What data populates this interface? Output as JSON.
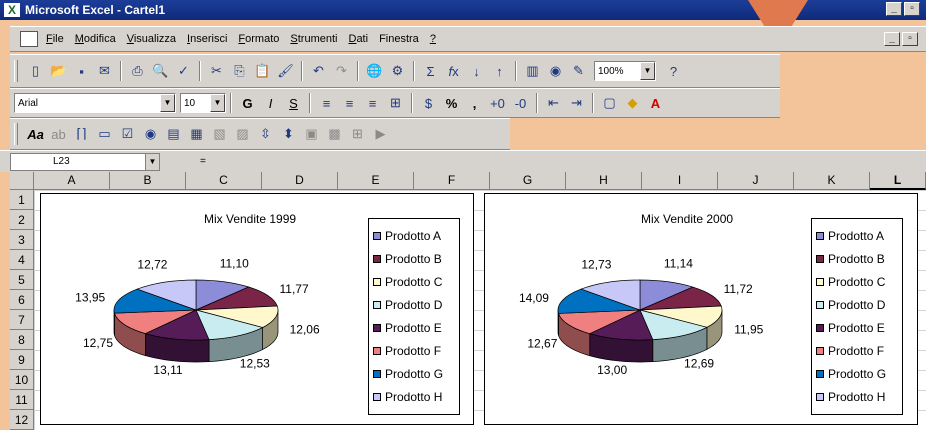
{
  "window": {
    "title": "Microsoft Excel - Cartel1",
    "app_icon": "X"
  },
  "menubar": {
    "items": [
      {
        "first": "F",
        "rest": "ile"
      },
      {
        "first": "M",
        "rest": "odifica"
      },
      {
        "first": "V",
        "rest": "isualizza"
      },
      {
        "first": "I",
        "rest": "nserisci"
      },
      {
        "first": "F",
        "rest": "ormato"
      },
      {
        "first": "S",
        "rest": "trumenti"
      },
      {
        "first": "D",
        "rest": "ati"
      },
      {
        "first": "",
        "rest": "Finestra"
      },
      {
        "first": "?",
        "rest": ""
      }
    ]
  },
  "toolbar_standard": {
    "zoom": "100%"
  },
  "toolbar_formatting": {
    "font": "Arial",
    "size": "10"
  },
  "formula_bar": {
    "cell_ref": "L23",
    "equals": "="
  },
  "columns": [
    "A",
    "B",
    "C",
    "D",
    "E",
    "F",
    "G",
    "H",
    "I",
    "J",
    "K",
    "L"
  ],
  "rows": [
    "1",
    "2",
    "3",
    "4",
    "5",
    "6",
    "7",
    "8",
    "9",
    "10",
    "11",
    "12"
  ],
  "series_colors": [
    "#8c8cd8",
    "#7a2448",
    "#fff8cc",
    "#c8ecf0",
    "#551c58",
    "#f08080",
    "#0070c0",
    "#c8c8f8"
  ],
  "chart_data": [
    {
      "type": "pie",
      "title": "Mix Vendite 1999",
      "categories": [
        "Prodotto A",
        "Prodotto B",
        "Prodotto C",
        "Prodotto D",
        "Prodotto E",
        "Prodotto F",
        "Prodotto G",
        "Prodotto H"
      ],
      "values": [
        11.1,
        11.77,
        12.06,
        12.53,
        13.11,
        12.75,
        13.95,
        12.72
      ],
      "labels": [
        "11,10",
        "11,77",
        "12,06",
        "12,53",
        "13,11",
        "12,75",
        "13,95",
        "12,72"
      ],
      "legend": "right",
      "style": "3d-exploded"
    },
    {
      "type": "pie",
      "title": "Mix Vendite 2000",
      "categories": [
        "Prodotto A",
        "Prodotto B",
        "Prodotto C",
        "Prodotto D",
        "Prodotto E",
        "Prodotto F",
        "Prodotto G",
        "Prodotto H"
      ],
      "values": [
        11.14,
        11.72,
        11.95,
        12.69,
        13.0,
        12.67,
        14.09,
        12.73
      ],
      "labels": [
        "11,14",
        "11,72",
        "11,95",
        "12,69",
        "13,00",
        "12,67",
        "14,09",
        "12,73"
      ],
      "legend": "right",
      "style": "3d-exploded"
    }
  ]
}
